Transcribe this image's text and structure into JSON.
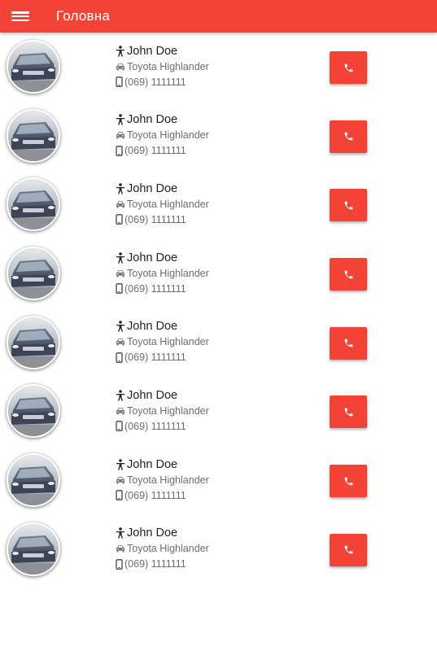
{
  "appbar": {
    "title": "Головна",
    "menu_icon": "hamburger-menu-icon",
    "color": "#f44336"
  },
  "contacts": [
    {
      "name": "John Doe",
      "car": "Toyota Highlander",
      "phone": "(069) 1111111"
    },
    {
      "name": "John Doe",
      "car": "Toyota Highlander",
      "phone": "(069) 1111111"
    },
    {
      "name": "John Doe",
      "car": "Toyota Highlander",
      "phone": "(069) 1111111"
    },
    {
      "name": "John Doe",
      "car": "Toyota Highlander",
      "phone": "(069) 1111111"
    },
    {
      "name": "John Doe",
      "car": "Toyota Highlander",
      "phone": "(069) 1111111"
    },
    {
      "name": "John Doe",
      "car": "Toyota Highlander",
      "phone": "(069) 1111111"
    },
    {
      "name": "John Doe",
      "car": "Toyota Highlander",
      "phone": "(069) 1111111"
    },
    {
      "name": "John Doe",
      "car": "Toyota Highlander",
      "phone": "(069) 1111111"
    }
  ],
  "icons": {
    "person": "person-icon",
    "car": "car-icon",
    "phone": "mobile-phone-icon",
    "call": "phone-call-icon"
  }
}
